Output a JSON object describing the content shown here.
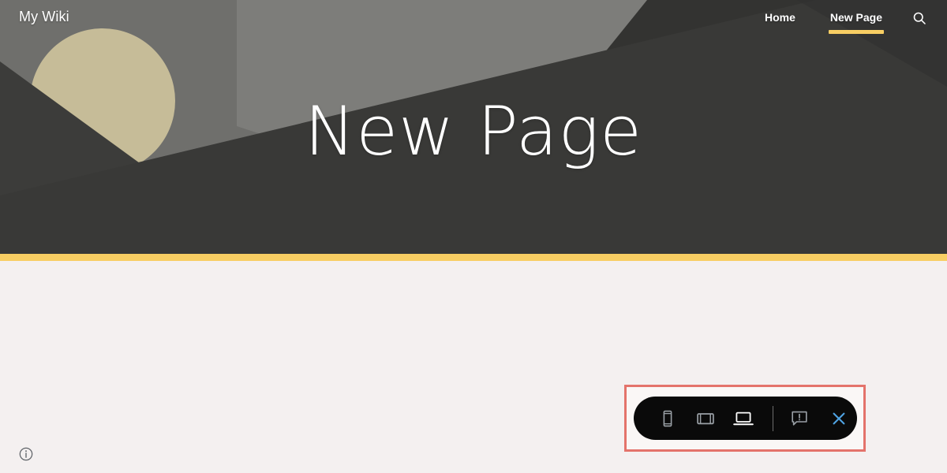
{
  "site": {
    "title": "My Wiki"
  },
  "nav": {
    "items": [
      {
        "label": "Home",
        "active": false
      },
      {
        "label": "New Page",
        "active": true
      }
    ],
    "search_icon": "search-icon"
  },
  "hero": {
    "title": "New Page",
    "accent_color": "#f8ce63",
    "banner_bg": "#3a3a38",
    "banner_shape_tan": "#c6bc98",
    "banner_shape_light": "#7d7d7a",
    "banner_shape_dark": "#2e2e2c"
  },
  "body": {
    "background": "#f4f0f0",
    "content": ""
  },
  "info_badge": {
    "icon": "info-circle-icon",
    "label": ""
  },
  "annotation": {
    "border_color": "#e4736b",
    "fill_color": "#faf7f6"
  },
  "device_toolbar": {
    "background": "#0a0a0a",
    "active_color": "#ffffff",
    "inactive_color": "#9aa0a6",
    "close_color": "#4fa3e3",
    "buttons": [
      {
        "id": "phone",
        "icon": "phone-icon",
        "label": "Mobile preview",
        "active": false
      },
      {
        "id": "tablet",
        "icon": "tablet-icon",
        "label": "Tablet preview",
        "active": false
      },
      {
        "id": "laptop",
        "icon": "laptop-icon",
        "label": "Desktop preview",
        "active": true
      },
      {
        "id": "feedback",
        "icon": "feedback-icon",
        "label": "Send feedback",
        "active": false
      },
      {
        "id": "close",
        "icon": "close-icon",
        "label": "Exit preview",
        "active": false
      }
    ]
  }
}
